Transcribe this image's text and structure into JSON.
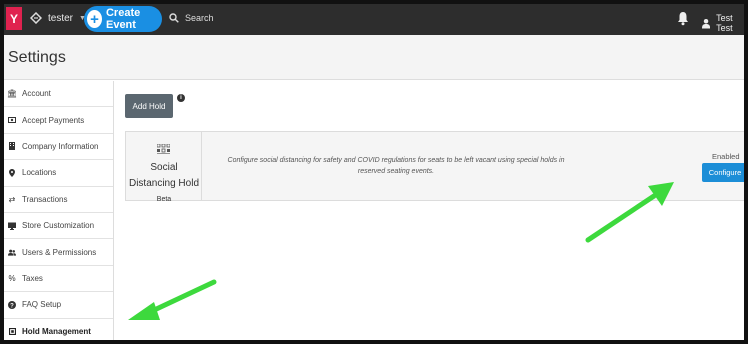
{
  "topbar": {
    "logo": "Y",
    "org_name": "tester",
    "create_event_label": "Create Event",
    "search_label": "Search",
    "user_name": "Test Test"
  },
  "page": {
    "title": "Settings"
  },
  "sidebar": {
    "items": [
      {
        "label": "Account",
        "icon": "bank-icon"
      },
      {
        "label": "Accept Payments",
        "icon": "money-icon"
      },
      {
        "label": "Company Information",
        "icon": "building-icon"
      },
      {
        "label": "Locations",
        "icon": "map-marker-icon"
      },
      {
        "label": "Transactions",
        "icon": "exchange-icon"
      },
      {
        "label": "Store Customization",
        "icon": "desktop-icon"
      },
      {
        "label": "Users & Permissions",
        "icon": "users-icon"
      },
      {
        "label": "Taxes",
        "icon": "percent-icon"
      },
      {
        "label": "FAQ Setup",
        "icon": "question-circle-icon"
      },
      {
        "label": "Hold Management",
        "icon": "hold-icon",
        "active": true
      }
    ]
  },
  "main": {
    "add_hold_label": "Add Hold",
    "hold": {
      "name": "Social Distancing Hold",
      "badge": "Beta",
      "description": "Configure social distancing for safety and COVID regulations for seats to be left vacant using special holds in reserved seating events.",
      "status": "Enabled",
      "configure_label": "Configure"
    }
  },
  "colors": {
    "brand": "#e0224f",
    "primary": "#1a8fe3",
    "navbar": "#2d2d2d",
    "arrow": "#3dd93d"
  }
}
